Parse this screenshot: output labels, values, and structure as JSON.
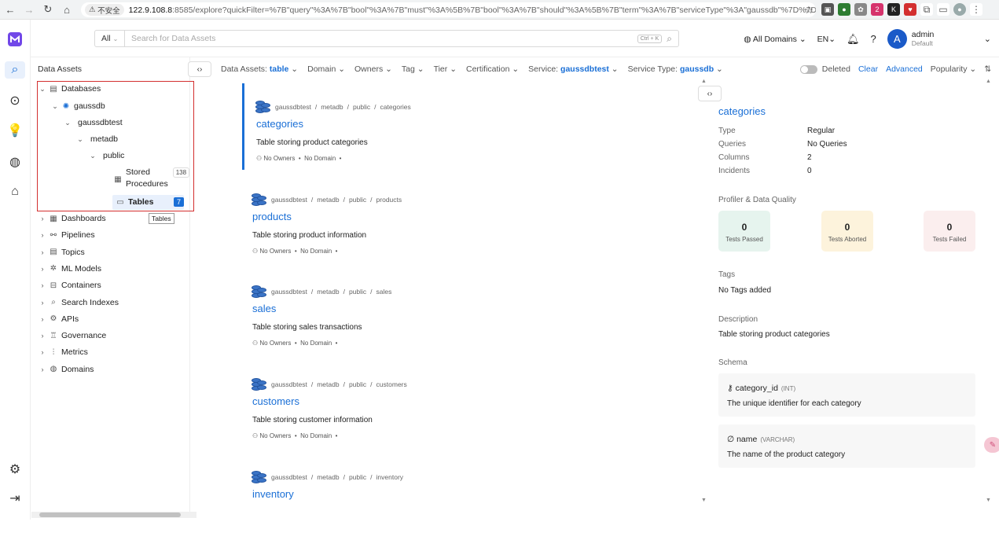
{
  "browser": {
    "insecure_label": "不安全",
    "url_host": "122.9.108.8",
    "url_rest": ":8585/explore?quickFilter=%7B\"query\"%3A%7B\"bool\"%3A%7B\"must\"%3A%5B%7B\"bool\"%3A%7B\"should\"%3A%5B%7B\"term\"%3A%7B\"serviceType\"%3A\"gaussdb\"%7D%7D%5D..."
  },
  "topbar": {
    "search_scope": "All",
    "search_placeholder": "Search for Data Assets",
    "kbd_hint": "Ctrl + K",
    "domains_label": "All Domains",
    "lang_label": "EN",
    "avatar_initial": "A",
    "user_name": "admin",
    "user_role": "Default"
  },
  "sidebar": {
    "title": "Data Assets",
    "databases": "Databases",
    "service": "gaussdb",
    "database": "gaussdbtest",
    "schema_db": "metadb",
    "schema": "public",
    "stored_procedures_1": "Stored",
    "stored_procedures_2": "Procedures",
    "stored_procedures_count": "138",
    "tables": "Tables",
    "tables_count": "7",
    "tooltip": "Tables",
    "items": [
      "Dashboards",
      "Pipelines",
      "Topics",
      "ML Models",
      "Containers",
      "Search Indexes",
      "APIs",
      "Governance",
      "Metrics",
      "Domains"
    ]
  },
  "filters": {
    "data_assets_label": "Data Assets:",
    "data_assets_value": "table",
    "domain": "Domain",
    "owners": "Owners",
    "tag": "Tag",
    "tier": "Tier",
    "certification": "Certification",
    "service_label": "Service:",
    "service_value": "gaussdbtest",
    "service_type_label": "Service Type:",
    "service_type_value": "gaussdb",
    "deleted": "Deleted",
    "clear": "Clear",
    "advanced": "Advanced",
    "sort": "Popularity"
  },
  "results": [
    {
      "db": "gaussdbtest",
      "schema_db": "metadb",
      "schema": "public",
      "table": "categories",
      "name": "categories",
      "desc": "Table storing product categories",
      "owners": "No Owners",
      "domain": "No Domain"
    },
    {
      "db": "gaussdbtest",
      "schema_db": "metadb",
      "schema": "public",
      "table": "products",
      "name": "products",
      "desc": "Table storing product information",
      "owners": "No Owners",
      "domain": "No Domain"
    },
    {
      "db": "gaussdbtest",
      "schema_db": "metadb",
      "schema": "public",
      "table": "sales",
      "name": "sales",
      "desc": "Table storing sales transactions",
      "owners": "No Owners",
      "domain": "No Domain"
    },
    {
      "db": "gaussdbtest",
      "schema_db": "metadb",
      "schema": "public",
      "table": "customers",
      "name": "customers",
      "desc": "Table storing customer information",
      "owners": "No Owners",
      "domain": "No Domain"
    },
    {
      "db": "gaussdbtest",
      "schema_db": "metadb",
      "schema": "public",
      "table": "inventory",
      "name": "inventory",
      "desc": "",
      "owners": "",
      "domain": ""
    }
  ],
  "detail": {
    "title": "categories",
    "type_label": "Type",
    "type_value": "Regular",
    "queries_label": "Queries",
    "queries_value": "No Queries",
    "columns_label": "Columns",
    "columns_value": "2",
    "incidents_label": "Incidents",
    "incidents_value": "0",
    "profiler_label": "Profiler & Data Quality",
    "tests_passed": "0",
    "tests_passed_label": "Tests Passed",
    "tests_aborted": "0",
    "tests_aborted_label": "Tests Aborted",
    "tests_failed": "0",
    "tests_failed_label": "Tests Failed",
    "tags_label": "Tags",
    "tags_value": "No Tags added",
    "description_label": "Description",
    "description_value": "Table storing product categories",
    "schema_label": "Schema",
    "columns": [
      {
        "name": "category_id",
        "type": "(INT)",
        "desc": "The unique identifier for each category"
      },
      {
        "name": "name",
        "type": "(VARCHAR)",
        "desc": "The name of the product category"
      }
    ]
  },
  "colors": {
    "accent": "#1a6fd6",
    "selection_border": "#d32f2f",
    "passed_bg": "#e6f4ee",
    "aborted_bg": "#fdf3dc",
    "failed_bg": "#fbeeee"
  }
}
